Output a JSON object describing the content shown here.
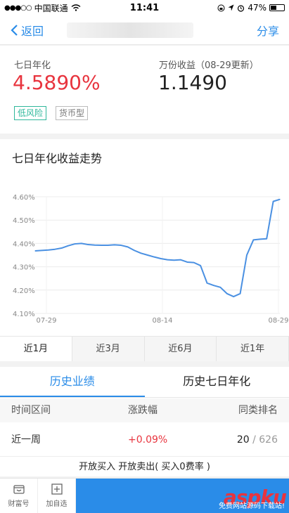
{
  "status_bar": {
    "carrier": "中国联通",
    "time": "11:41",
    "battery": "47%",
    "battery_level": 0.47
  },
  "nav": {
    "back_label": "返回",
    "share_label": "分享"
  },
  "summary": {
    "seven_day_label": "七日年化",
    "seven_day_value": "4.5890%",
    "per_10k_label": "万份收益（08-29更新）",
    "per_10k_value": "1.1490",
    "tags": [
      "低风险",
      "货币型"
    ]
  },
  "chart_title": "七日年化收益走势",
  "chart_data": {
    "type": "line",
    "title": "",
    "xlabel": "",
    "ylabel": "",
    "y_ticks": [
      "4.60%",
      "4.50%",
      "4.40%",
      "4.30%",
      "4.20%",
      "4.10%"
    ],
    "x_ticks": [
      "07-29",
      "08-14",
      "08-29"
    ],
    "ylim": [
      4.1,
      4.6
    ],
    "grid": true,
    "series": [
      {
        "values": [
          4.368,
          4.37,
          4.372,
          4.375,
          4.38,
          4.39,
          4.398,
          4.4,
          4.395,
          4.393,
          4.392,
          4.392,
          4.394,
          4.392,
          4.385,
          4.37,
          4.358,
          4.35,
          4.342,
          4.335,
          4.33,
          4.328,
          4.33,
          4.32,
          4.318,
          4.305,
          4.23,
          4.22,
          4.212,
          4.185,
          4.172,
          4.185,
          4.35,
          4.415,
          4.418,
          4.42,
          4.58,
          4.589
        ]
      }
    ],
    "color": "#4a90e2"
  },
  "range_tabs": [
    "近1月",
    "近3月",
    "近6月",
    "近1年"
  ],
  "perf": {
    "tabs": [
      "历史业绩",
      "历史七日年化"
    ],
    "headers": [
      "时间区间",
      "涨跌幅",
      "同类排名"
    ],
    "rows": [
      {
        "period": "近一周",
        "change": "+0.09%",
        "rank": "20",
        "total": "626"
      }
    ]
  },
  "bottom": {
    "banner": "开放买入  开放卖出( 买入0费率 )",
    "items": [
      "财富号",
      "加自选"
    ],
    "watermark": "aspku",
    "watermark_sub": "免费网站源码下载站!"
  },
  "colors": {
    "accent": "#2a8ce8",
    "red": "#e8343e",
    "green_tag": "#2fb89b"
  }
}
